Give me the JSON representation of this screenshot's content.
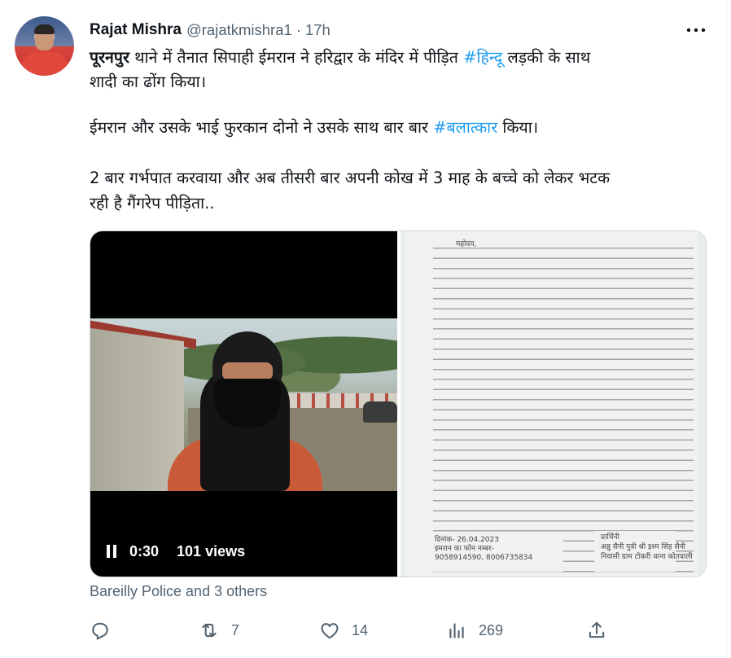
{
  "tweet": {
    "author_name": "Rajat Mishra",
    "author_handle": "@rajatkmishra1",
    "separator": "·",
    "time": "17h",
    "more_icon": "more-dots-icon",
    "lines": {
      "l1_bold": "पूरनपुर",
      "l1_text": " थाने में तैनात सिपाही ईमरान ने हरिद्वार के मंदिर में पीड़ित ",
      "l1_tag": "#हिन्दू",
      "l1_end": " लड़की के साथ",
      "l2": "शादी का ढोंग किया।",
      "l3_text": "ईमरान और उसके भाई फुरकान दोनो ने उसके साथ बार बार ",
      "l3_tag": "#बलात्कार",
      "l3_end": " किया।",
      "l4": "2 बार गर्भपात करवाया और अब तीसरी बार अपनी कोख में 3 माह के बच्चे को लेकर भटक",
      "l5": "रही है गैंगरेप पीड़िता.."
    },
    "video": {
      "time": "0:30",
      "views": "101 views",
      "pause_icon": "pause-icon"
    },
    "document": {
      "heading": "महोदय,",
      "left_date": "दिनांक- 26.04.2023",
      "left_phone_label": "इमरान का फोन नम्बर-",
      "left_phones": "9058914590, 8006735834",
      "right_label": "प्रार्थिनी",
      "right_name": "अन्नु सैनी पुत्री श्री इश्म सिंह सैनी",
      "right_place": "निवासी ग्राम टोकरी थाना कोतवाली"
    },
    "credit": "Bareilly Police and 3 others",
    "actions": {
      "reply_icon": "reply-icon",
      "retweet_icon": "retweet-icon",
      "retweet_count": "7",
      "like_icon": "heart-icon",
      "like_count": "14",
      "views_icon": "views-chart-icon",
      "views_count": "269",
      "share_icon": "share-icon"
    },
    "colors": {
      "link": "#1d9bf0",
      "muted": "#536471",
      "text": "#0f1419"
    }
  }
}
